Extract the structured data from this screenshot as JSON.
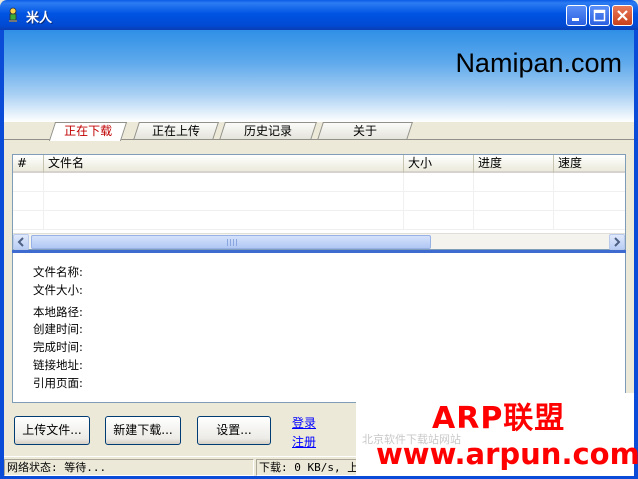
{
  "window": {
    "title": "米人"
  },
  "banner": {
    "brand": "Namipan.com"
  },
  "tabs": [
    {
      "label": "正在下载",
      "active": true
    },
    {
      "label": "正在上传",
      "active": false
    },
    {
      "label": "历史记录",
      "active": false
    },
    {
      "label": "关于",
      "active": false
    }
  ],
  "list": {
    "columns": [
      "#",
      "文件名",
      "大小",
      "进度",
      "速度"
    ],
    "rows": [
      [],
      [],
      []
    ]
  },
  "details": {
    "labels": [
      "文件名称:",
      "文件大小:",
      "本地路径:",
      "创建时间:",
      "完成时间:",
      "链接地址:",
      "引用页面:"
    ]
  },
  "buttons": {
    "upload": "上传文件...",
    "new_download": "新建下载...",
    "settings": "设置..."
  },
  "links": {
    "login": "登录",
    "register": "注册"
  },
  "status": {
    "network": "网络状态: 等待...",
    "speed": "下载: 0 KB/s, 上传"
  },
  "watermark": {
    "top": "ARP联盟",
    "bottom": "www.arpun.com"
  },
  "colors": {
    "titlebar": "#0054e3",
    "active_tab_text": "#c00000",
    "watermark": "#ff0000",
    "link": "#0000ff"
  }
}
